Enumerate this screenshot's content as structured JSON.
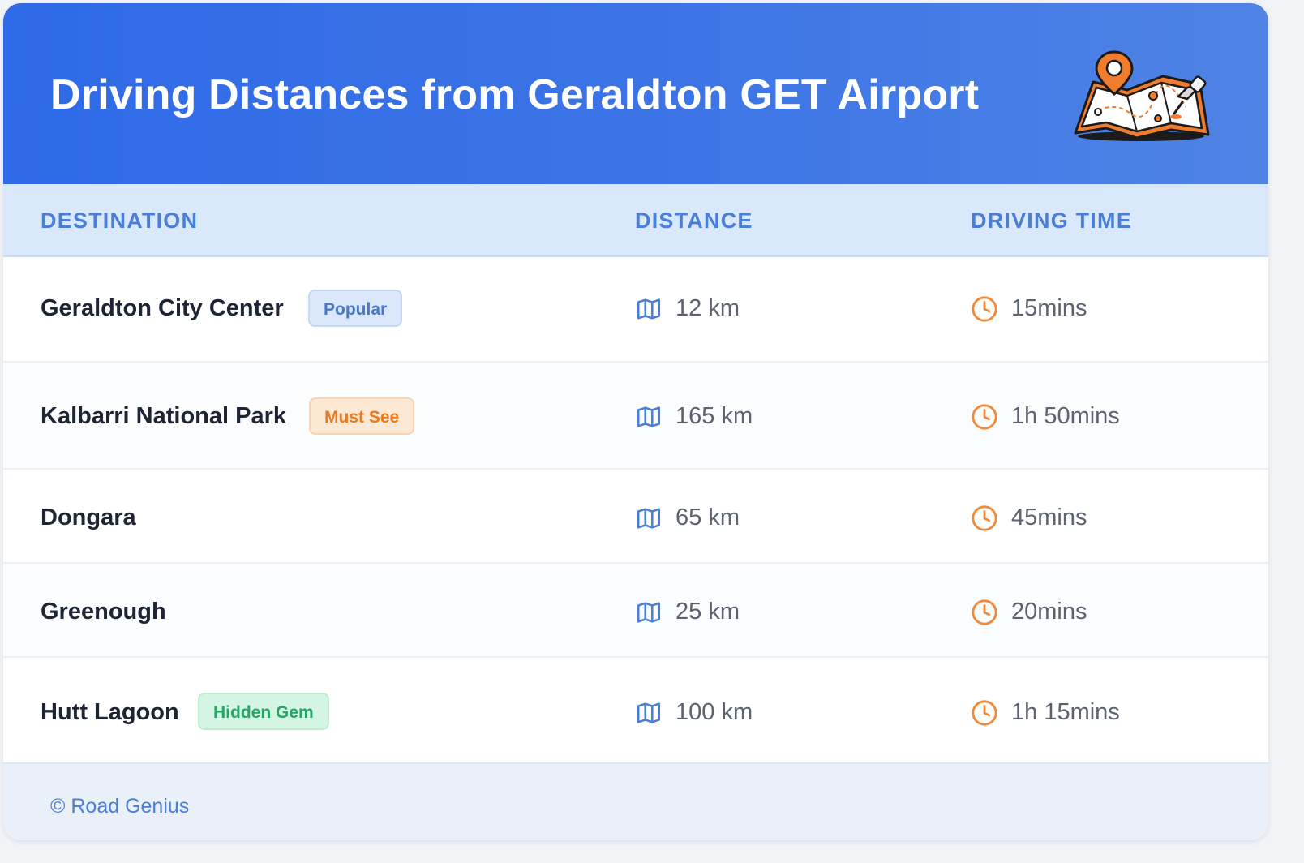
{
  "header": {
    "title": "Driving Distances from Geraldton GET Airport",
    "illustration_icon": "map-with-pins-icon"
  },
  "table": {
    "columns": [
      "DESTINATION",
      "DISTANCE",
      "DRIVING TIME"
    ],
    "rows": [
      {
        "destination": "Geraldton City Center",
        "badge": "Popular",
        "badge_style": "blue",
        "distance": "12 km",
        "time": "15mins"
      },
      {
        "destination": "Kalbarri National Park",
        "badge": "Must See",
        "badge_style": "orange",
        "distance": "165 km",
        "time": "1h 50mins"
      },
      {
        "destination": "Dongara",
        "badge": "",
        "badge_style": "",
        "distance": "65 km",
        "time": "45mins"
      },
      {
        "destination": "Greenough",
        "badge": "",
        "badge_style": "",
        "distance": "25 km",
        "time": "20mins"
      },
      {
        "destination": "Hutt Lagoon",
        "badge": "Hidden Gem",
        "badge_style": "green",
        "distance": "100 km",
        "time": "1h 15mins"
      }
    ],
    "distance_icon": "map-icon",
    "time_icon": "clock-icon"
  },
  "footer": {
    "text": "© Road Genius"
  },
  "colors": {
    "header_start": "#2f6ae7",
    "header_end": "#4f83e4",
    "accent_blue": "#4a7fd8",
    "accent_orange": "#ef8a3c",
    "badge_green": "#22a863"
  }
}
